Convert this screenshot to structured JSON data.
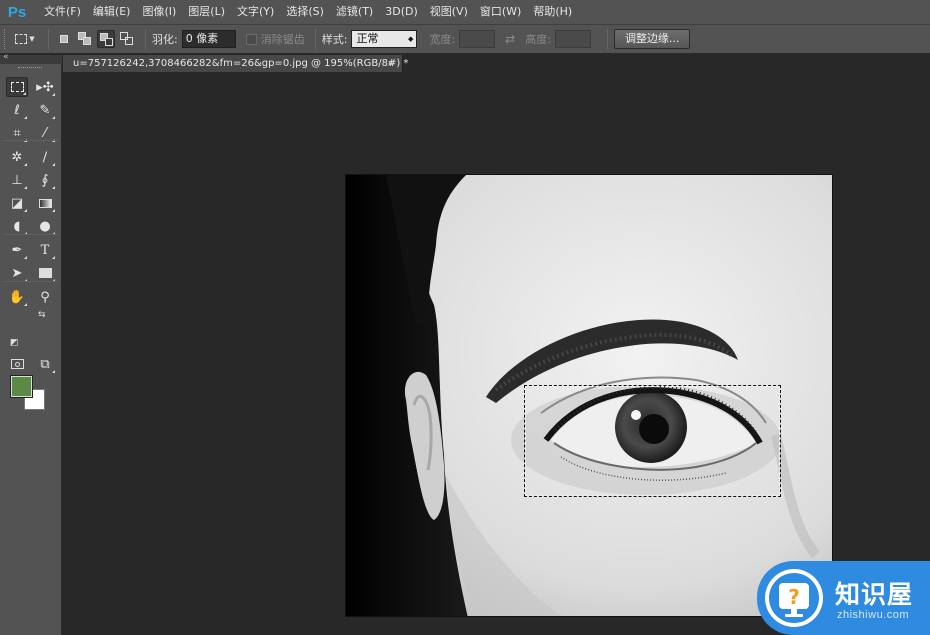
{
  "app": {
    "logo": "Ps"
  },
  "menu": {
    "items": [
      "文件(F)",
      "编辑(E)",
      "图像(I)",
      "图层(L)",
      "文字(Y)",
      "选择(S)",
      "滤镜(T)",
      "3D(D)",
      "视图(V)",
      "窗口(W)",
      "帮助(H)"
    ]
  },
  "options": {
    "feather_label": "羽化:",
    "feather_value": "0 像素",
    "antialias_label": "消除锯齿",
    "style_label": "样式:",
    "style_value": "正常",
    "width_label": "宽度:",
    "height_label": "高度:",
    "refine_edge_label": "调整边缘..."
  },
  "document": {
    "tab_title": "u=757126242,3708466282&fm=26&gp=0.jpg @ 195%(RGB/8#) *",
    "close_glyph": "×"
  },
  "colors": {
    "foreground": "#5a8a44",
    "background": "#ffffff",
    "accent": "#2ea7e0",
    "watermark_blue": "#2e8be0"
  },
  "tools": [
    {
      "name": "rectangular-marquee-icon",
      "glyph": "⬚"
    },
    {
      "name": "move-icon",
      "glyph": "▸"
    },
    {
      "name": "lasso-icon",
      "glyph": "ᑭ"
    },
    {
      "name": "quick-selection-icon",
      "glyph": "✎"
    },
    {
      "name": "crop-icon",
      "glyph": "⌗"
    },
    {
      "name": "eyedropper-icon",
      "glyph": "⁄"
    },
    {
      "name": "healing-brush-icon",
      "glyph": "✲"
    },
    {
      "name": "brush-icon",
      "glyph": "∕"
    },
    {
      "name": "clone-stamp-icon",
      "glyph": "⊥"
    },
    {
      "name": "history-brush-icon",
      "glyph": "∮"
    },
    {
      "name": "eraser-icon",
      "glyph": "◪"
    },
    {
      "name": "gradient-icon",
      "glyph": "▬"
    },
    {
      "name": "blur-icon",
      "glyph": "◖"
    },
    {
      "name": "dodge-icon",
      "glyph": "●"
    },
    {
      "name": "pen-icon",
      "glyph": "✒"
    },
    {
      "name": "type-icon",
      "glyph": "T"
    },
    {
      "name": "path-selection-icon",
      "glyph": "➤"
    },
    {
      "name": "rectangle-shape-icon",
      "glyph": "▭"
    },
    {
      "name": "hand-icon",
      "glyph": "✋"
    },
    {
      "name": "zoom-icon",
      "glyph": "⚲"
    },
    {
      "name": "quick-mask-icon",
      "glyph": "◙"
    },
    {
      "name": "screen-mode-icon",
      "glyph": "⧉"
    }
  ],
  "watermark": {
    "title": "知识屋",
    "url": "zhishiwu.com"
  }
}
